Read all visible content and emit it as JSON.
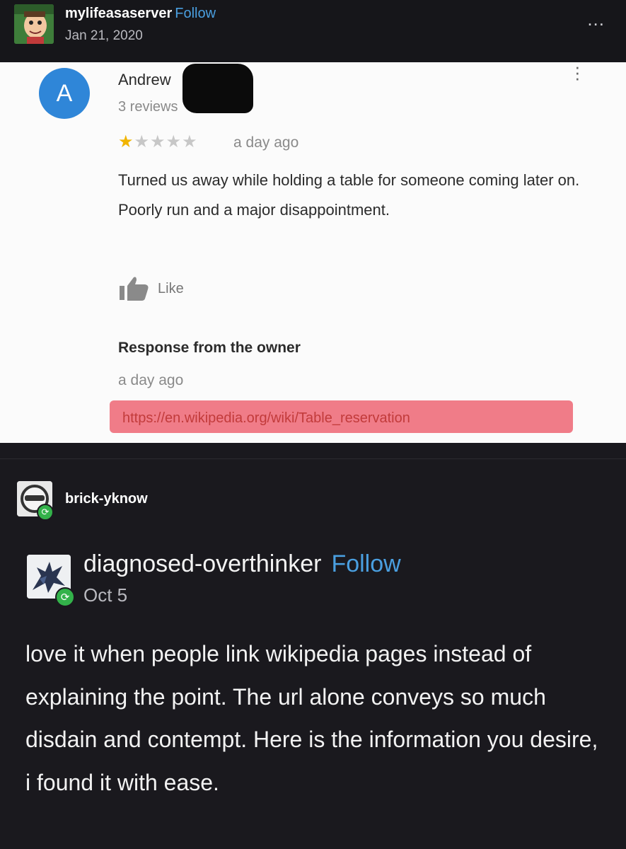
{
  "top_post": {
    "username": "mylifeasaserver",
    "follow_label": "Follow",
    "date": "Jan 21, 2020",
    "menu_label": "..."
  },
  "review": {
    "avatar_letter": "A",
    "reviewer_name": "Andrew",
    "review_count": "3 reviews",
    "rating": 1,
    "rating_max": 5,
    "age": "a day ago",
    "text": "Turned us away while holding a table for someone coming later on. Poorly run and a major disappointment.",
    "like_label": "Like",
    "owner_heading": "Response from the owner",
    "owner_age": "a day ago",
    "owner_link": "https://en.wikipedia.org/wiki/Table_reservation",
    "colors": {
      "avatar": "#2f86d8",
      "star": "#f1b400",
      "highlight": "#f07c88"
    }
  },
  "reblog": {
    "reblogger": "brick-yknow",
    "op_username": "diagnosed-overthinker",
    "op_follow_label": "Follow",
    "op_date": "Oct 5",
    "op_text": "love it when people link wikipedia pages instead of explaining the point. The url alone conveys so much disdain and contempt. Here is the information you desire, i found it with ease.",
    "colors": {
      "follow": "#4a9fe0",
      "reblog_badge": "#33b24a"
    }
  }
}
